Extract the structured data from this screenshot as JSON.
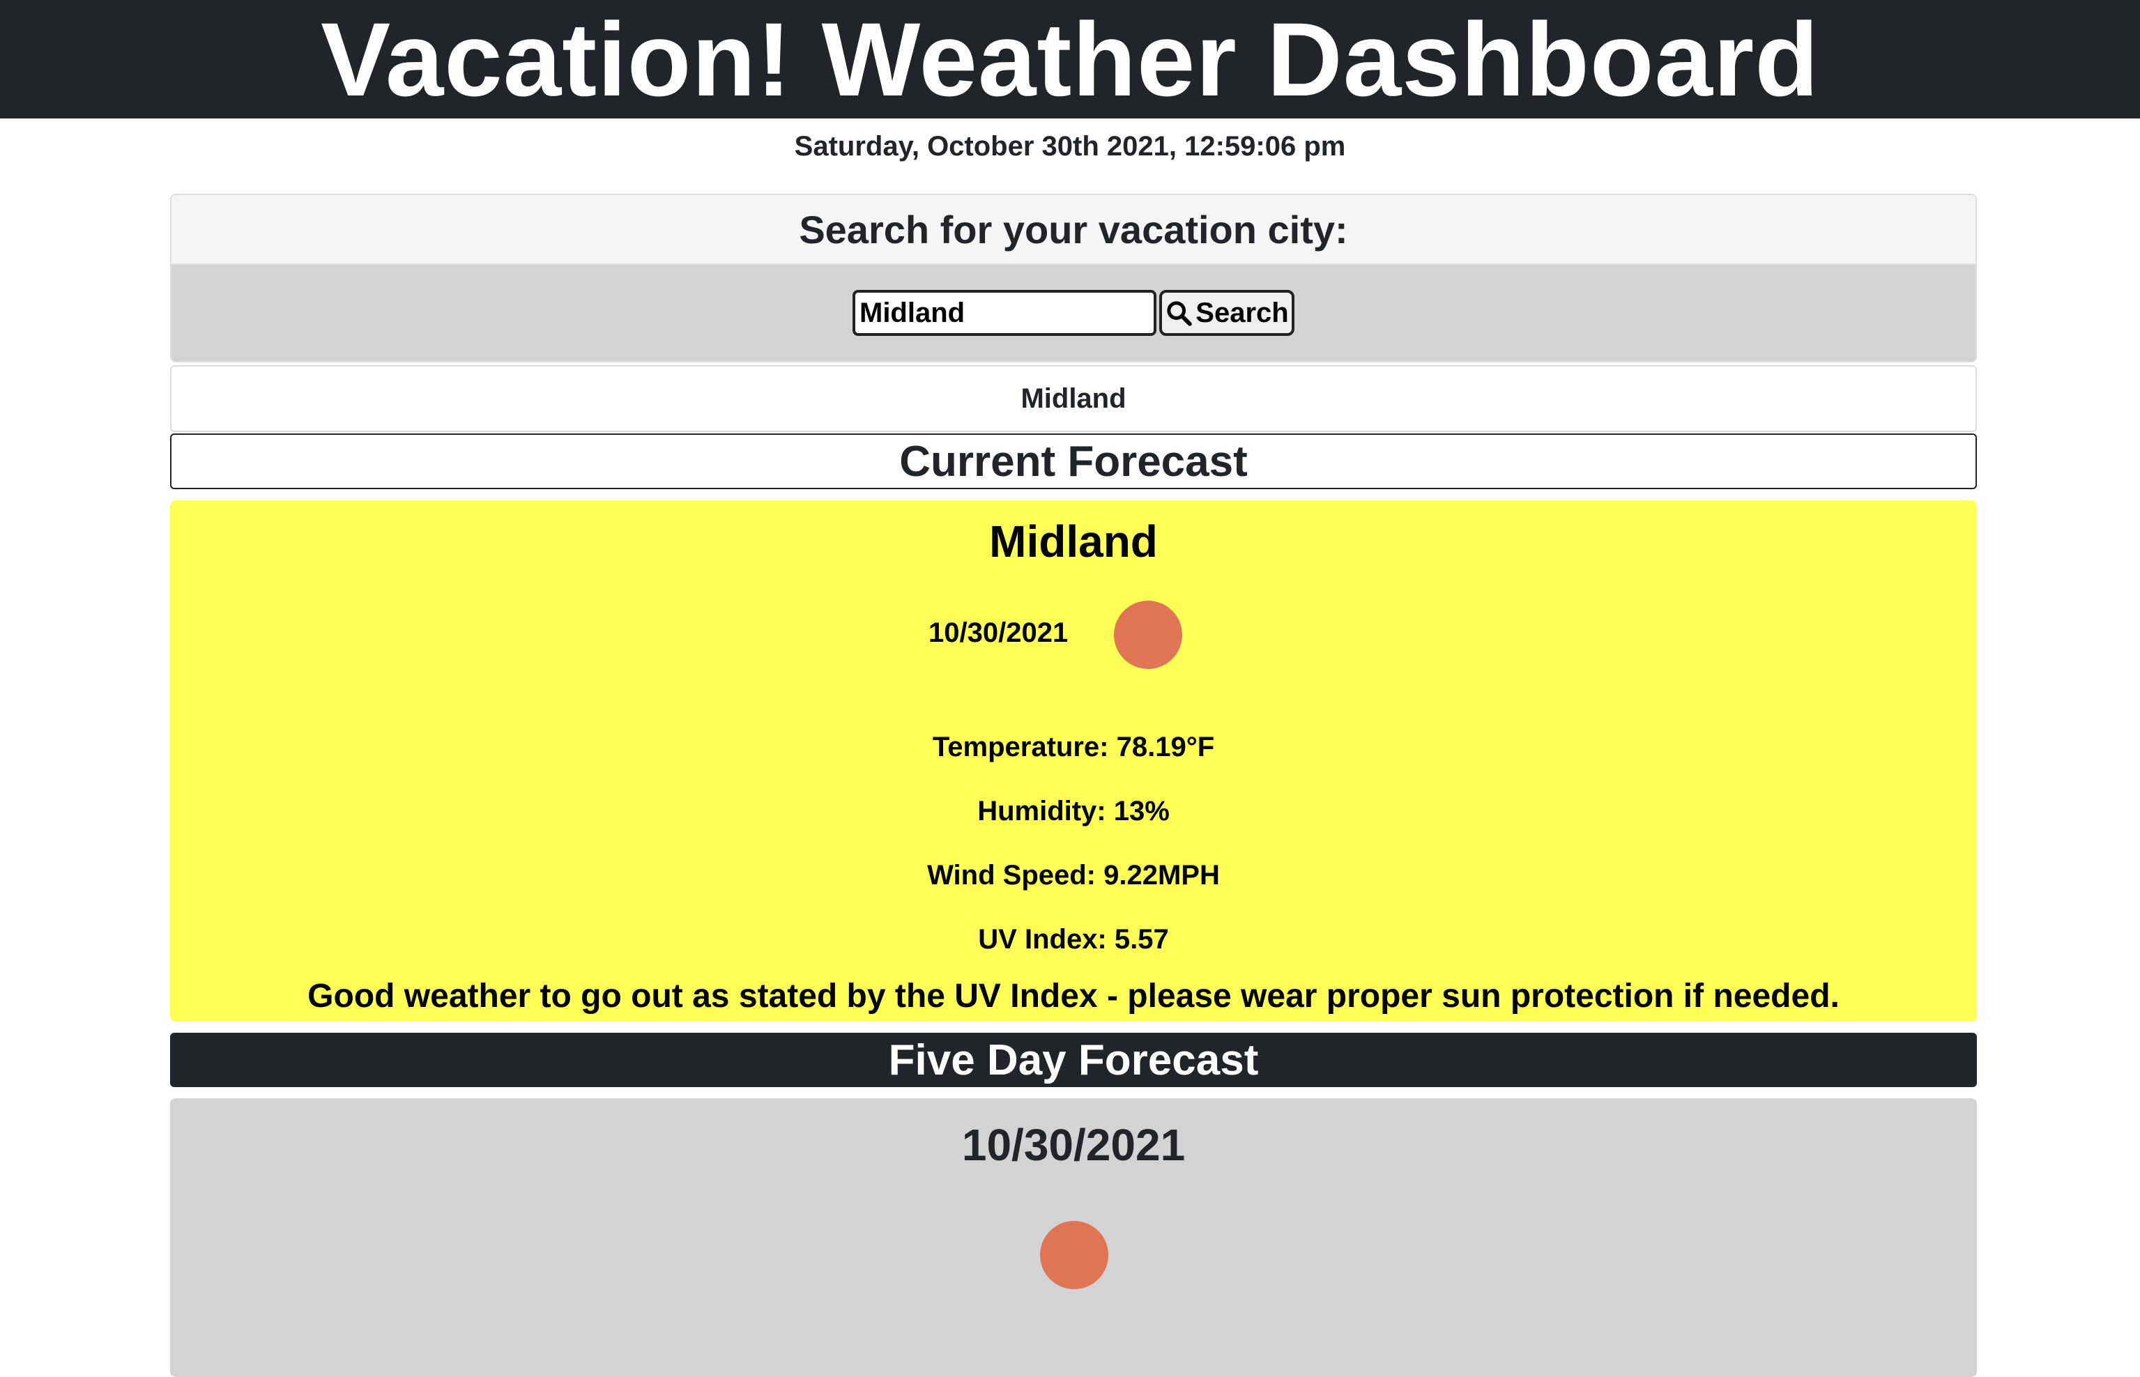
{
  "header": {
    "title": "Vacation! Weather Dashboard",
    "datetime": "Saturday, October 30th 2021, 12:59:06 pm"
  },
  "search": {
    "heading": "Search for your vacation city:",
    "input_value": "Midland",
    "button_label": "Search",
    "button_icon": "search-icon"
  },
  "history": {
    "items": [
      {
        "label": "Midland"
      }
    ]
  },
  "current": {
    "section_title": "Current Forecast",
    "city": "Midland",
    "date": "10/30/2021",
    "icon": "weather-icon",
    "temperature": "Temperature: 78.19°F",
    "humidity": "Humidity: 13%",
    "wind": "Wind Speed: 9.22MPH",
    "uv": "UV Index: 5.57",
    "advice": "Good weather to go out as stated by the UV Index - please wear proper sun protection if needed.",
    "card_color": "#ffff55"
  },
  "five_day": {
    "section_title": "Five Day Forecast",
    "days": [
      {
        "date": "10/30/2021",
        "icon": "weather-icon"
      }
    ]
  },
  "colors": {
    "header_bg": "#212529",
    "icon_color": "#e07555",
    "forecast_card_bg": "#d3d3d3"
  }
}
